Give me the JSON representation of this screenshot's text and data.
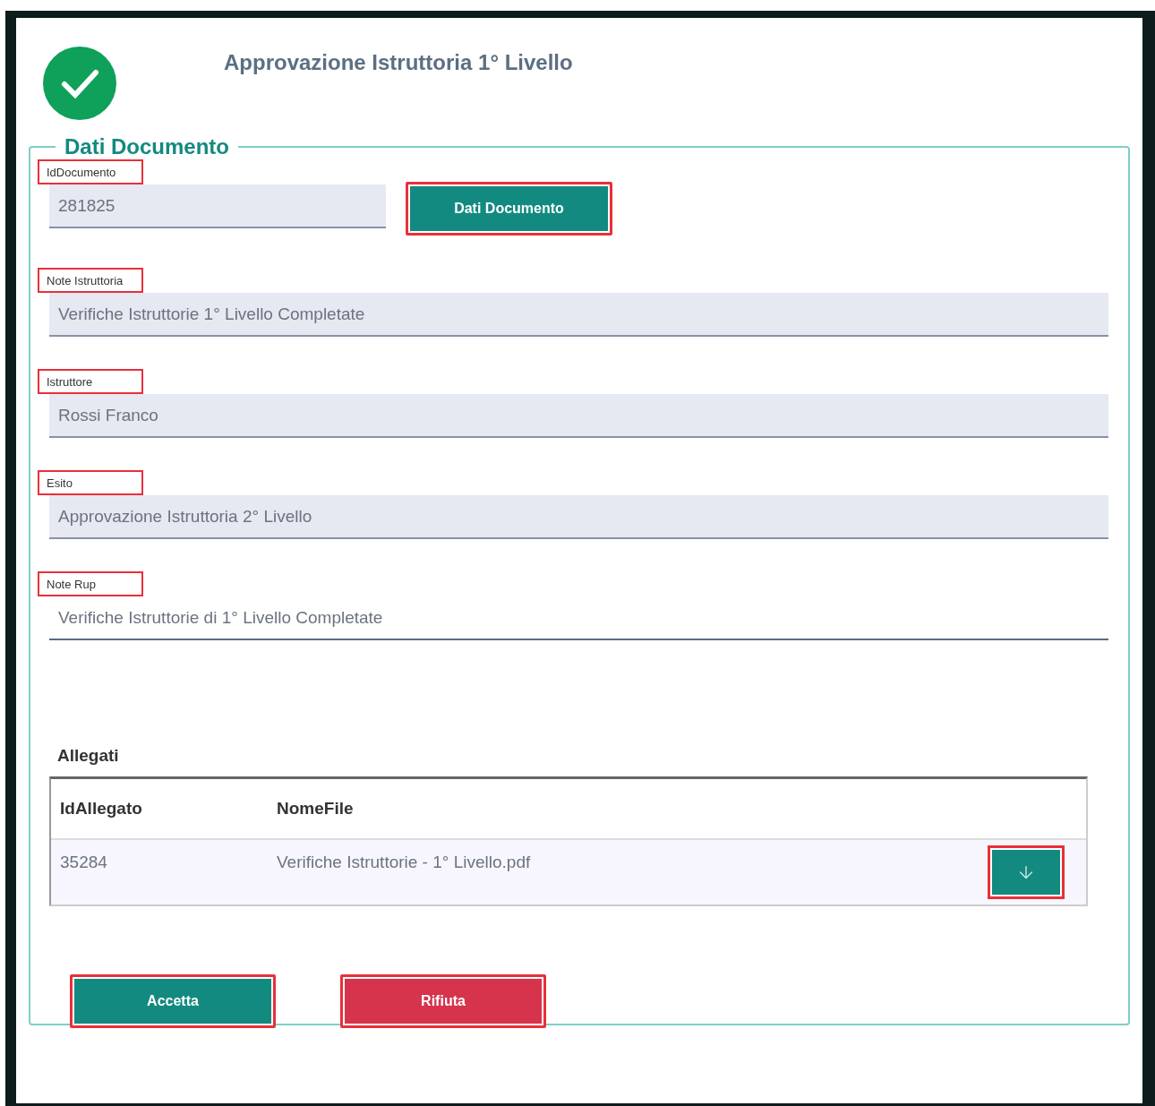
{
  "dialog": {
    "title": "Approvazione Istruttoria 1° Livello",
    "section": {
      "legend": "Dati Documento",
      "id_field": {
        "label": "IdDocumento",
        "value": "281825",
        "highlighted": true
      },
      "details_button": {
        "label": "Dati Documento",
        "highlighted": true
      },
      "fields": [
        {
          "label": "Note Istruttoria",
          "value": "Verifiche Istruttorie 1° Livello Completate",
          "kind": "filled",
          "highlighted": true
        },
        {
          "label": "Istruttore",
          "value": "Rossi Franco",
          "kind": "filled",
          "highlighted": true
        },
        {
          "label": "Esito",
          "value": "Approvazione Istruttoria 2° Livello",
          "kind": "filled",
          "highlighted": true
        },
        {
          "label": "Note Rup",
          "value": "Verifiche Istruttorie di 1° Livello Completate",
          "kind": "plain",
          "highlighted": true
        }
      ],
      "attachments": {
        "title": "Allegati",
        "columns": [
          "IdAllegato",
          "NomeFile"
        ],
        "rows": [
          {
            "id": "35284",
            "file": "Verifiche Istruttorie - 1° Livello.pdf",
            "download_highlighted": true
          }
        ]
      },
      "buttons": [
        {
          "label": "Accetta",
          "kind": "accept",
          "highlighted": true
        },
        {
          "label": "Rifiuta",
          "kind": "reject",
          "highlighted": true
        }
      ]
    }
  }
}
